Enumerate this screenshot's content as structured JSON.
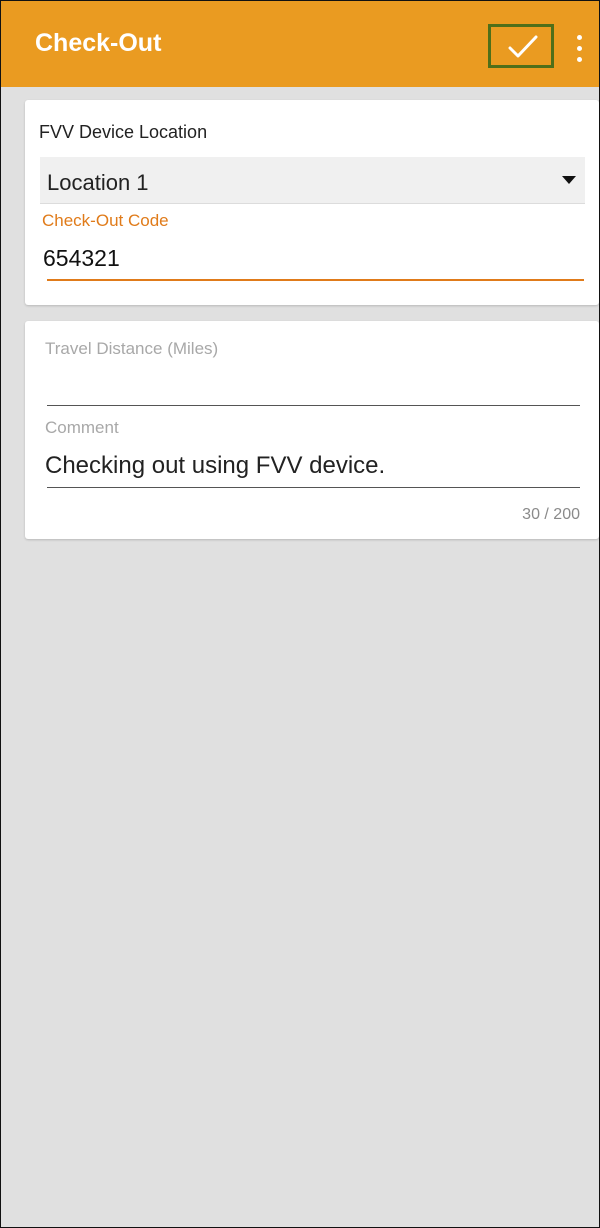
{
  "header": {
    "title": "Check-Out",
    "confirm_icon": "checkmark-icon",
    "more_icon": "more-vertical-icon",
    "background_color": "#ea9b21"
  },
  "device_card": {
    "location_label": "FVV Device Location",
    "location_selected": "Location 1",
    "code_label": "Check-Out Code",
    "code_value": "654321",
    "accent_color": "#e07b1a"
  },
  "details_card": {
    "travel_label": "Travel Distance (Miles)",
    "travel_value": "",
    "comment_label": "Comment",
    "comment_value": "Checking out using FVV device.",
    "char_counter": "30 / 200"
  }
}
